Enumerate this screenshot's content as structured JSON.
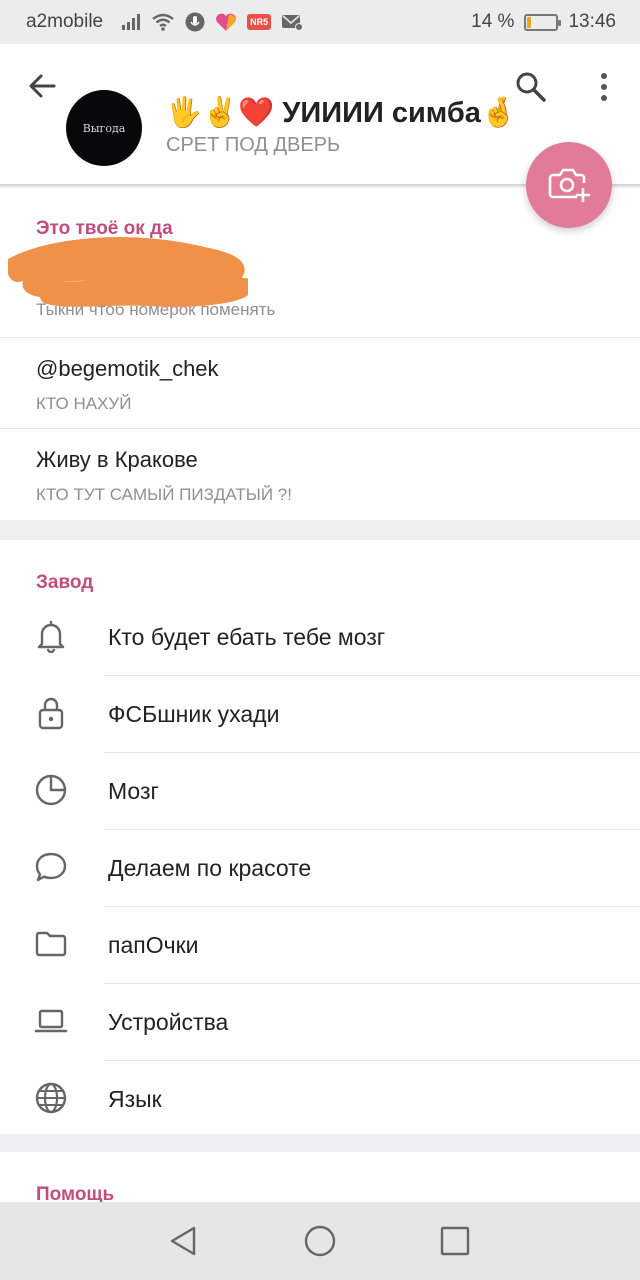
{
  "status_bar": {
    "carrier": "a2mobile",
    "battery_percent_text": "14 %",
    "battery_level": 0.14,
    "battery_color": "#f0a323",
    "time": "13:46",
    "badge_text": "NR5",
    "icons": [
      "signal-icon",
      "wifi-icon",
      "mic-icon",
      "app-heart-icon",
      "badge-icon",
      "mail-icon"
    ]
  },
  "header": {
    "name": "🖐✌️❤️  УИИИИ симба🤞",
    "status": "СРЕТ ПОД ДВЕРЬ",
    "avatar_text": "Выгода",
    "avatar_color": "#08080b",
    "fab_color": "#e17b97"
  },
  "account": {
    "section_title": "Это твоё ок да",
    "phone_hint": "Тыкни чтоб номерок поменять",
    "username": "@begemotik_chek",
    "username_label": "КТО НАХУЙ",
    "bio": "Живу в Кракове",
    "bio_label": "КТО ТУТ САМЫЙ ПИЗДАТЫЙ ?!",
    "redaction_color": "#f0914a"
  },
  "settings": {
    "section_title": "Завод",
    "items": [
      {
        "label": "Кто будет ебать тебе мозг",
        "icon": "bell-icon"
      },
      {
        "label": "ФСБшник ухади",
        "icon": "lock-icon"
      },
      {
        "label": "Мозг",
        "icon": "pie-chart-icon"
      },
      {
        "label": "Делаем по красоте",
        "icon": "chat-bubble-icon"
      },
      {
        "label": "папОчки",
        "icon": "folder-icon"
      },
      {
        "label": "Устройства",
        "icon": "laptop-icon"
      },
      {
        "label": "Язык",
        "icon": "globe-icon"
      }
    ]
  },
  "help": {
    "section_title": "Помощь"
  },
  "colors": {
    "accent": "#c24d7d",
    "page_bg": "#efeff1"
  }
}
